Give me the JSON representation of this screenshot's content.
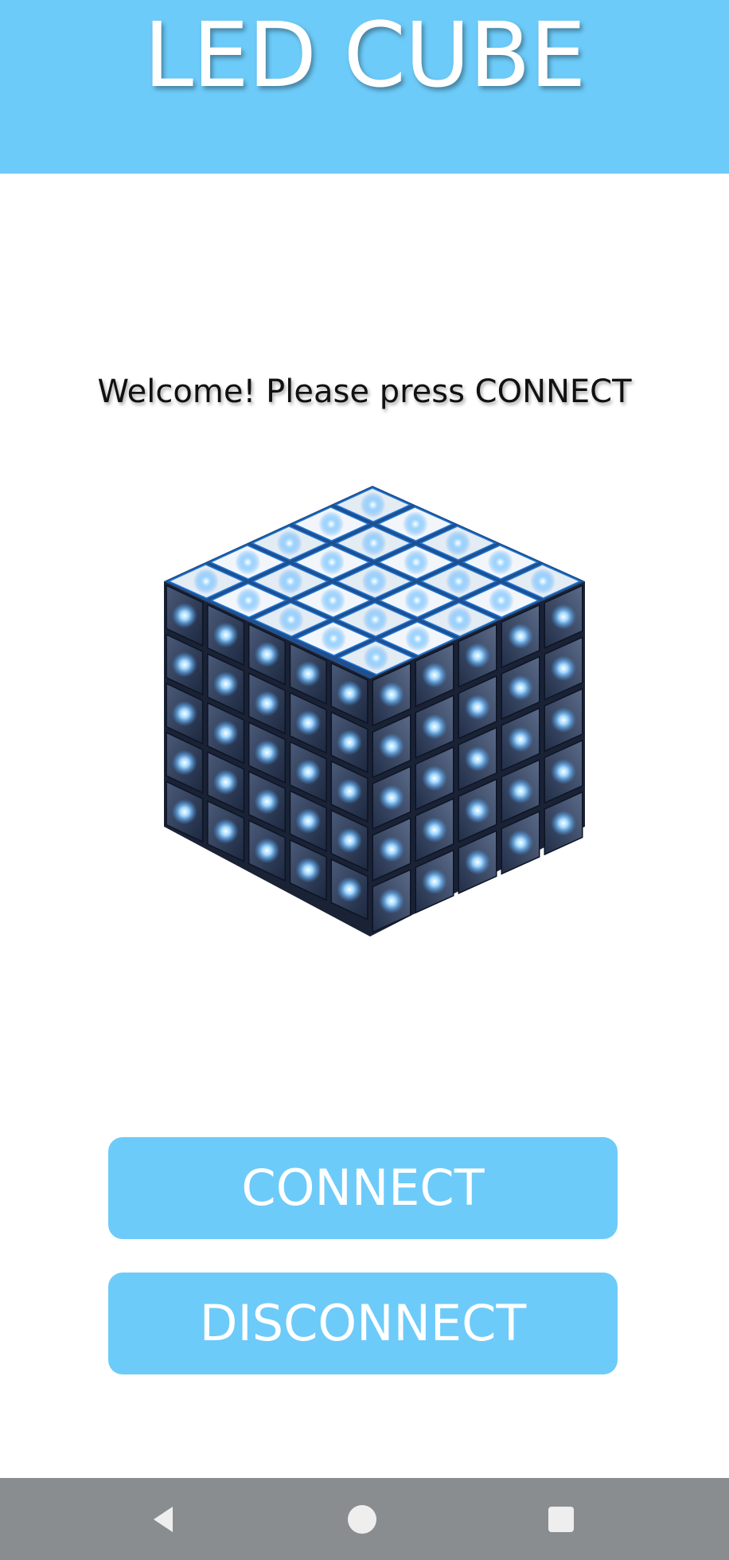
{
  "app": {
    "title": "LED CUBE",
    "colors": {
      "accent": "#6dcbf9",
      "navbar": "#8a8d90",
      "led_glow": "#3aa0ff"
    }
  },
  "main": {
    "welcome_text": "Welcome! Please press CONNECT",
    "illustration_icon": "led-cube-icon"
  },
  "buttons": {
    "connect_label": "CONNECT",
    "disconnect_label": "DISCONNECT"
  },
  "navbar": {
    "icons": [
      "back-icon",
      "home-icon",
      "recent-apps-icon"
    ]
  }
}
